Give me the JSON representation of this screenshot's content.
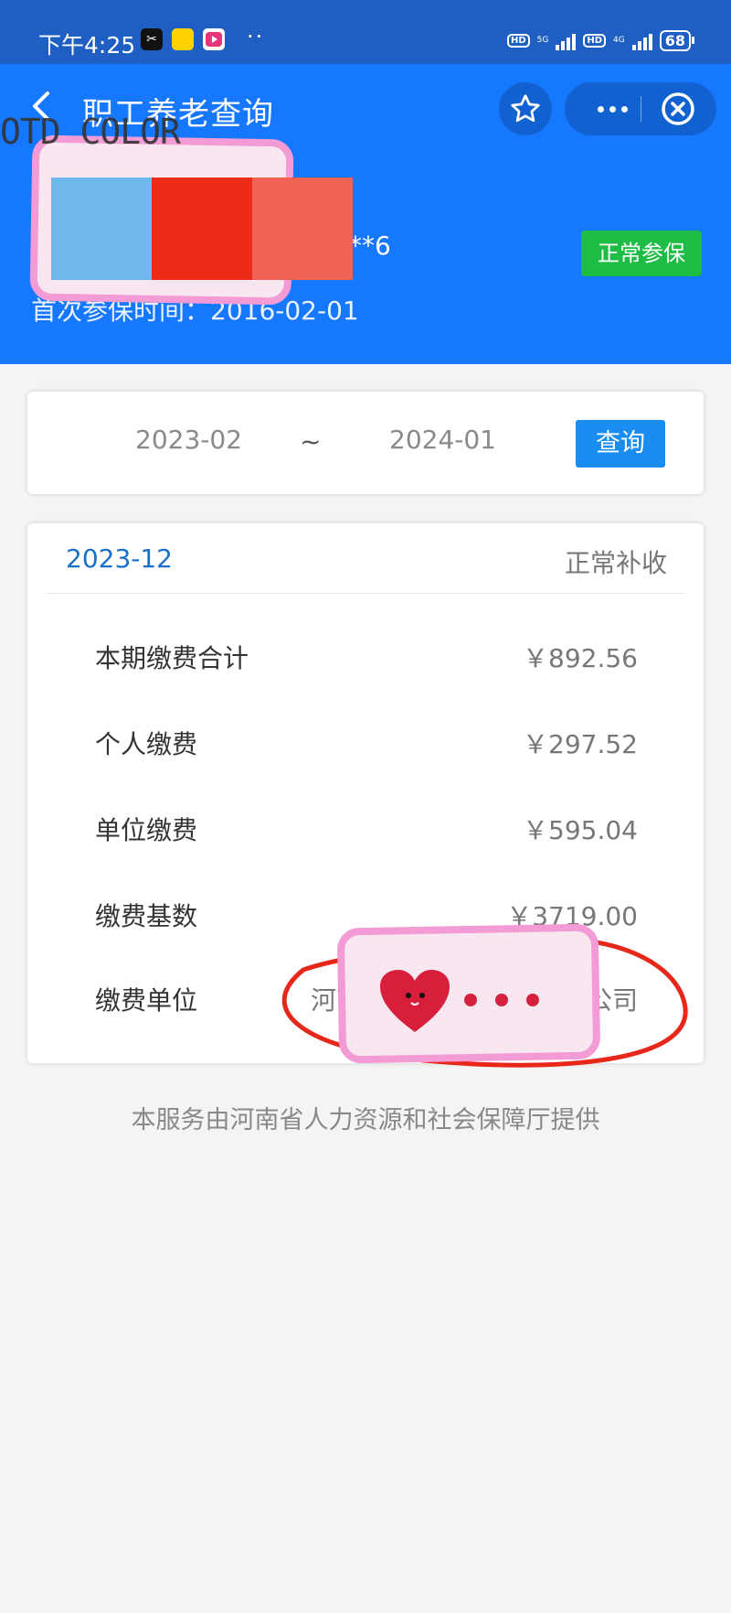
{
  "status_bar": {
    "time": "下午4:25",
    "app_icons": [
      "capcut-icon",
      "meituan-icon",
      "video-app-icon"
    ],
    "more": "··",
    "hd1": "HD",
    "net1": "5G",
    "hd2": "HD",
    "net2": "4G",
    "battery": "68"
  },
  "header": {
    "title": "职工养老查询",
    "watermark": "OTD COLOR",
    "masked_id_tail": "**6",
    "first_enroll_date": "首次参保时间：2016-02-01",
    "status_badge": "正常参保",
    "redaction_colors": [
      "#6fb8ee",
      "#ee2a18",
      "#f06253"
    ]
  },
  "query": {
    "start_date": "2023-02",
    "separator": "~",
    "end_date": "2024-01",
    "button": "查询"
  },
  "record": {
    "period": "2023-12",
    "type": "正常补收",
    "rows": [
      {
        "label": "本期缴费合计",
        "value": "￥892.56"
      },
      {
        "label": "个人缴费",
        "value": "￥297.52"
      },
      {
        "label": "单位缴费",
        "value": "￥595.04"
      },
      {
        "label": "缴费基数",
        "value": "￥3719.00"
      },
      {
        "label": "缴费单位",
        "value_left": "河南",
        "value_right": "公司"
      }
    ]
  },
  "footer": "本服务由河南省人力资源和社会保障厅提供",
  "colors": {
    "header_bg": "#1677ff",
    "status_bar_bg": "#1f5fc4",
    "badge_green": "#1ebc44",
    "query_button": "#1a8ef0",
    "period_blue": "#1a6fc9",
    "sticker_pink": "#f39bd5"
  }
}
